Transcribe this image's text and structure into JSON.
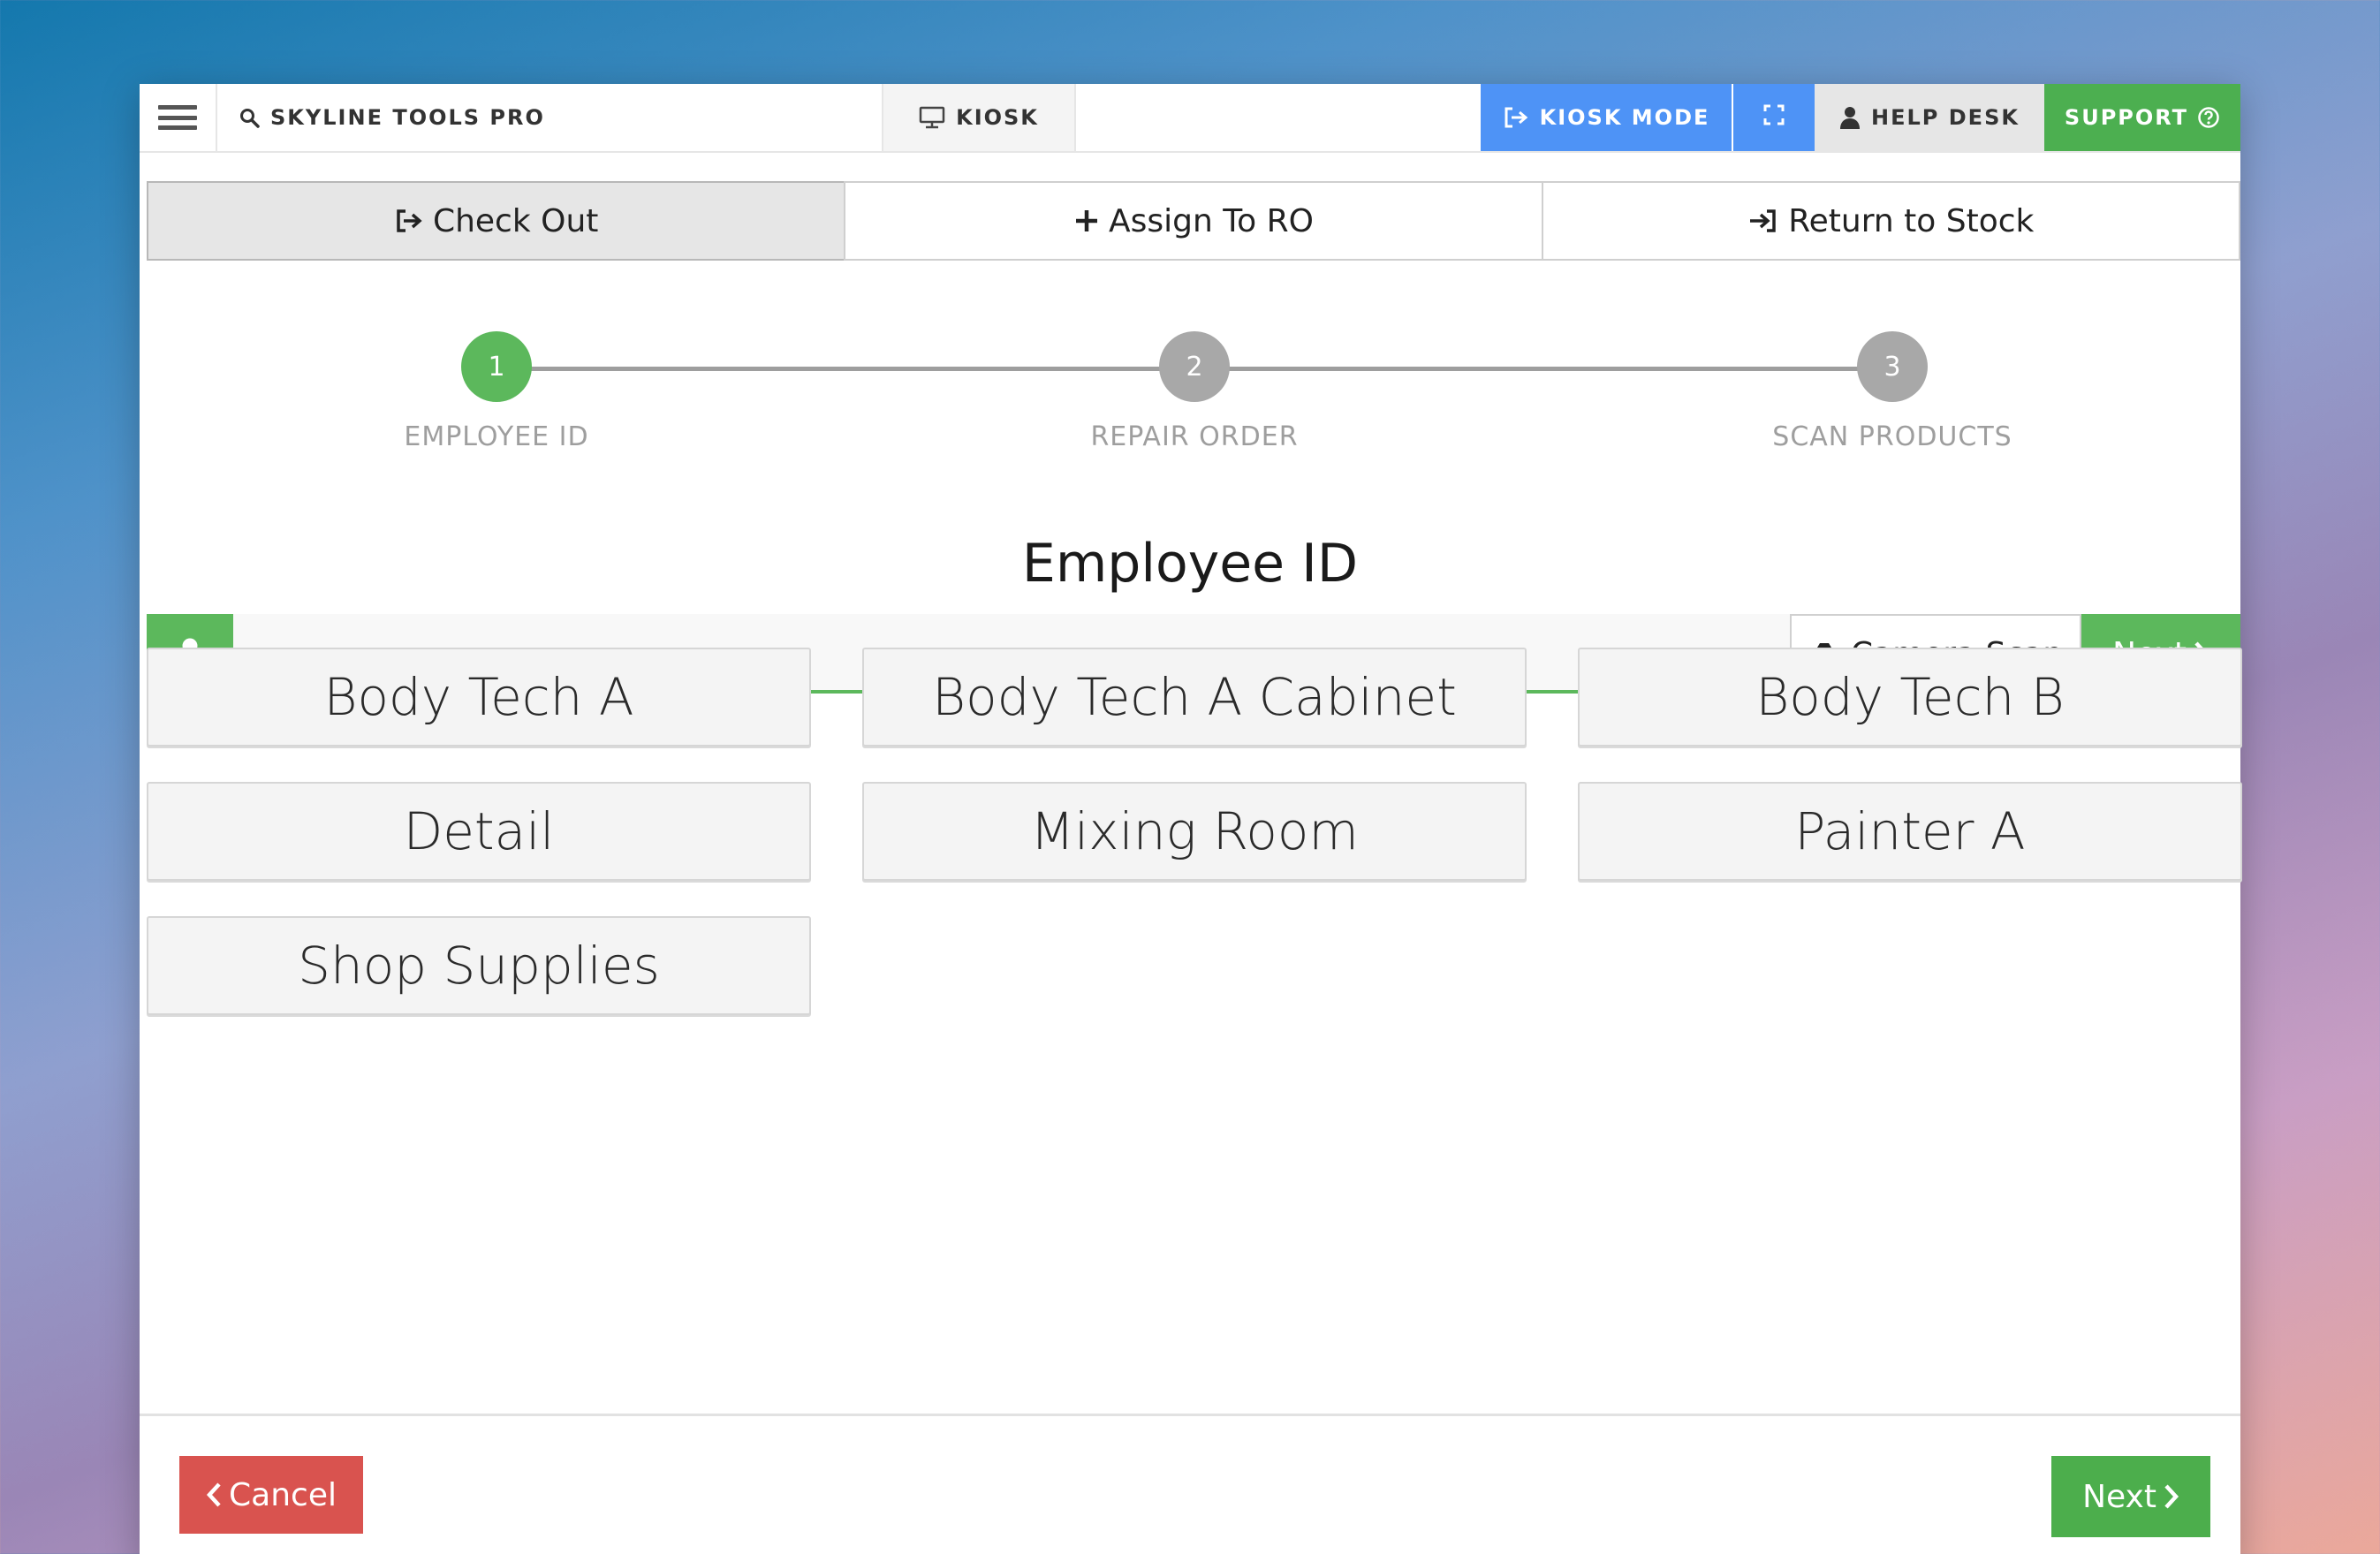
{
  "topbar": {
    "brand_label": "SKYLINE TOOLS PRO",
    "kiosk_label": "KIOSK",
    "kiosk_mode_label": "KIOSK MODE",
    "help_desk_label": "HELP DESK",
    "support_label": "SUPPORT",
    "colors": {
      "kiosk_mode_bg": "#4e93f6",
      "support_bg": "#4caf50"
    },
    "icons": [
      "hamburger-icon",
      "search-icon",
      "monitor-icon",
      "sign-out-icon",
      "expand-icon",
      "user-icon",
      "question-circle-icon"
    ]
  },
  "tabs": [
    {
      "label": "Check Out",
      "icon": "sign-out-icon",
      "active": true
    },
    {
      "label": "Assign To RO",
      "icon": "plus-icon",
      "active": false
    },
    {
      "label": "Return to Stock",
      "icon": "sign-in-icon",
      "active": false
    }
  ],
  "stepper": {
    "current": 1,
    "steps": [
      {
        "number": "1",
        "label": "EMPLOYEE ID"
      },
      {
        "number": "2",
        "label": "REPAIR ORDER"
      },
      {
        "number": "3",
        "label": "SCAN PRODUCTS"
      }
    ],
    "colors": {
      "active": "#5cb85c",
      "inactive": "#a8a8a8"
    }
  },
  "page_title": "Employee ID",
  "employee_input": {
    "value": "",
    "placeholder": "",
    "camera_scan_label": "Camera Scan",
    "next_label": "Next"
  },
  "employees": [
    "Body Tech A",
    "Body Tech A Cabinet",
    "Body Tech B",
    "Detail",
    "Mixing Room",
    "Painter A",
    "Shop Supplies"
  ],
  "footer": {
    "cancel_label": "Cancel",
    "next_label": "Next",
    "colors": {
      "cancel_bg": "#d9534f",
      "next_bg": "#4cae4c"
    }
  }
}
